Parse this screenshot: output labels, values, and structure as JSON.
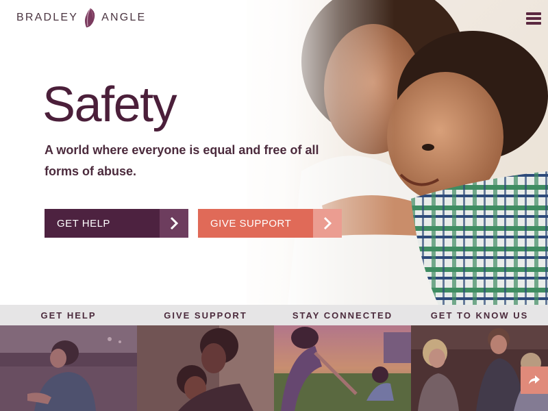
{
  "header": {
    "brand_left": "BRADLEY",
    "brand_right": "ANGLE",
    "logo_icon": "leaf-petal-icon",
    "menu_icon": "hamburger-menu-icon"
  },
  "hero": {
    "headline": "Safety",
    "tagline": "A world where everyone is equal and free of all forms of abuse.",
    "buttons": [
      {
        "label": "GET HELP",
        "icon": "chevron-right-icon"
      },
      {
        "label": "GIVE SUPPORT",
        "icon": "chevron-right-icon"
      }
    ]
  },
  "nav": {
    "items": [
      {
        "label": "GET HELP"
      },
      {
        "label": "GIVE SUPPORT"
      },
      {
        "label": "STAY CONNECTED"
      },
      {
        "label": "GET TO KNOW US"
      }
    ]
  },
  "share_icon": "share-arrow-icon",
  "colors": {
    "brand_plum": "#4d2240",
    "brand_plum_light": "#6d3d5e",
    "coral": "#e06a58",
    "coral_light": "#eb9d91",
    "nav_bg": "#e6e5e6",
    "text_dark": "#4b2a3c"
  }
}
